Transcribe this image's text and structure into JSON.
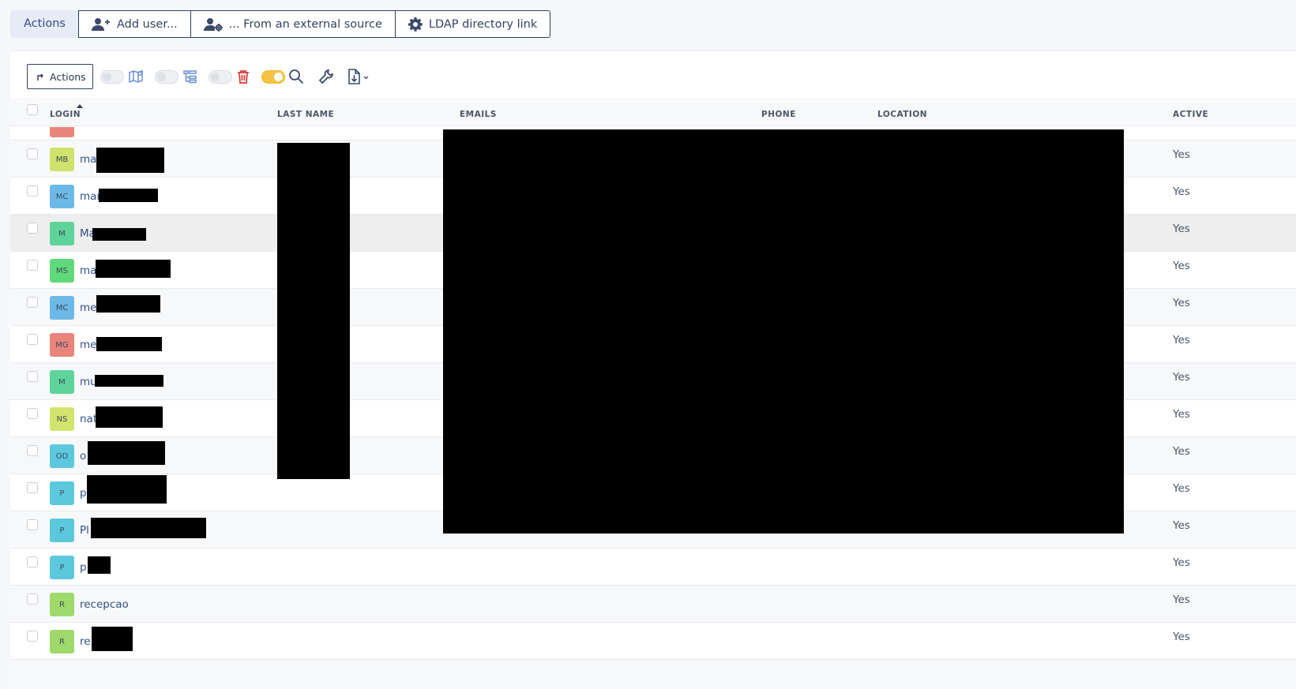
{
  "topbar": {
    "label": "Actions",
    "buttons": [
      {
        "label": "Add user...",
        "icon": "user-plus-icon"
      },
      {
        "label": "... From an external source",
        "icon": "user-gear-icon"
      },
      {
        "label": "LDAP directory link",
        "icon": "gear-icon"
      }
    ]
  },
  "toolbar": {
    "actions_label": "Actions",
    "toggles": [
      {
        "name": "map-toggle",
        "on": false,
        "icon": "map-icon"
      },
      {
        "name": "tree-toggle",
        "on": false,
        "icon": "tree-icon"
      },
      {
        "name": "trash-toggle",
        "on": false,
        "icon": "trash-icon"
      },
      {
        "name": "search-toggle",
        "on": true,
        "icon": "search-icon"
      }
    ],
    "colors": {
      "toggle_on": "#f5c343",
      "trash": "#d63939"
    }
  },
  "table": {
    "columns": {
      "login": "LOGIN",
      "last_name": "LAST NAME",
      "emails": "EMAILS",
      "phone": "PHONE",
      "location": "LOCATION",
      "active": "ACTIVE"
    },
    "rows": [
      {
        "initials": "MB",
        "color": "#cfe26b",
        "login": "ma",
        "active": "Yes"
      },
      {
        "initials": "MC",
        "color": "#6db9e6",
        "login": "mar",
        "active": "Yes"
      },
      {
        "initials": "M",
        "color": "#5fd49a",
        "login": "Ma",
        "active": "Yes"
      },
      {
        "initials": "MS",
        "color": "#5fd97a",
        "login": "ma",
        "active": "Yes"
      },
      {
        "initials": "MC",
        "color": "#6db9e6",
        "login": "me",
        "active": "Yes"
      },
      {
        "initials": "MG",
        "color": "#e8847c",
        "login": "me",
        "active": "Yes"
      },
      {
        "initials": "M",
        "color": "#5fd49a",
        "login": "mu",
        "active": "Yes"
      },
      {
        "initials": "NS",
        "color": "#d3e46c",
        "login": "nat",
        "active": "Yes"
      },
      {
        "initials": "OD",
        "color": "#5cc8de",
        "login": "o",
        "active": "Yes"
      },
      {
        "initials": "P",
        "color": "#5cc8de",
        "login": "p",
        "active": "Yes"
      },
      {
        "initials": "P",
        "color": "#5cc8de",
        "login": "Pl",
        "active": "Yes"
      },
      {
        "initials": "P",
        "color": "#5cc8de",
        "login": "p",
        "active": "Yes"
      },
      {
        "initials": "R",
        "color": "#9fd96b",
        "login": "recepcao",
        "active": "Yes"
      },
      {
        "initials": "R",
        "color": "#9fd96b",
        "login": "re",
        "active": "Yes"
      }
    ]
  }
}
